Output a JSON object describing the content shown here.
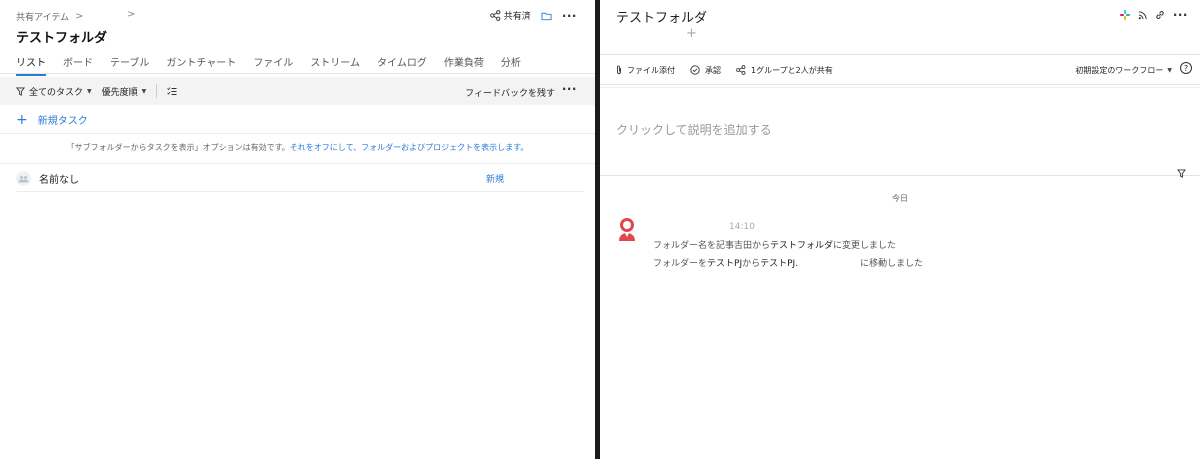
{
  "left": {
    "breadcrumb": {
      "root": "共有アイテム",
      "sep": ">",
      "sep2": ">"
    },
    "title": "テストフォルダ",
    "share_label": "共有済",
    "tabs": [
      {
        "label": "リスト",
        "active": true
      },
      {
        "label": "ボード"
      },
      {
        "label": "テーブル"
      },
      {
        "label": "ガントチャート"
      },
      {
        "label": "ファイル"
      },
      {
        "label": "ストリーム"
      },
      {
        "label": "タイムログ"
      },
      {
        "label": "作業負荷"
      },
      {
        "label": "分析"
      }
    ],
    "toolbar": {
      "all_tasks": "全てのタスク",
      "priority": "優先度順",
      "feedback": "フィードバックを残す"
    },
    "new_task_label": "新規タスク",
    "notice": {
      "text": "「サブフォルダーからタスクを表示」オプションは有効です。",
      "link": "それをオフにして、フォルダーおよびプロジェクトを表示します。"
    },
    "rows": [
      {
        "name": "名前なし",
        "status": "新規"
      }
    ]
  },
  "right": {
    "title": "テストフォルダ",
    "add_symbol": "+",
    "toolbar": {
      "attach": "ファイル添付",
      "approve": "承認",
      "shared": "1グループと2人が共有",
      "workflow": "初期設定のワークフロー"
    },
    "description_placeholder": "クリックして説明を追加する",
    "today_label": "今日",
    "activity": {
      "time": "14:10",
      "line1_prefix": "フォルダー名を記事吉田から",
      "line1_bold": "テストフォルダ",
      "line1_suffix": "に変更しました",
      "line2_a": "フォルダーを",
      "line2_b": "テストPJ",
      "line2_c": "から",
      "line2_d": "テストPJ.",
      "line2_e": "に移動しました"
    }
  },
  "colors": {
    "accent": "#2e7bd6",
    "divider": "#1b1b1b",
    "avatar_red": "#e0474c"
  }
}
